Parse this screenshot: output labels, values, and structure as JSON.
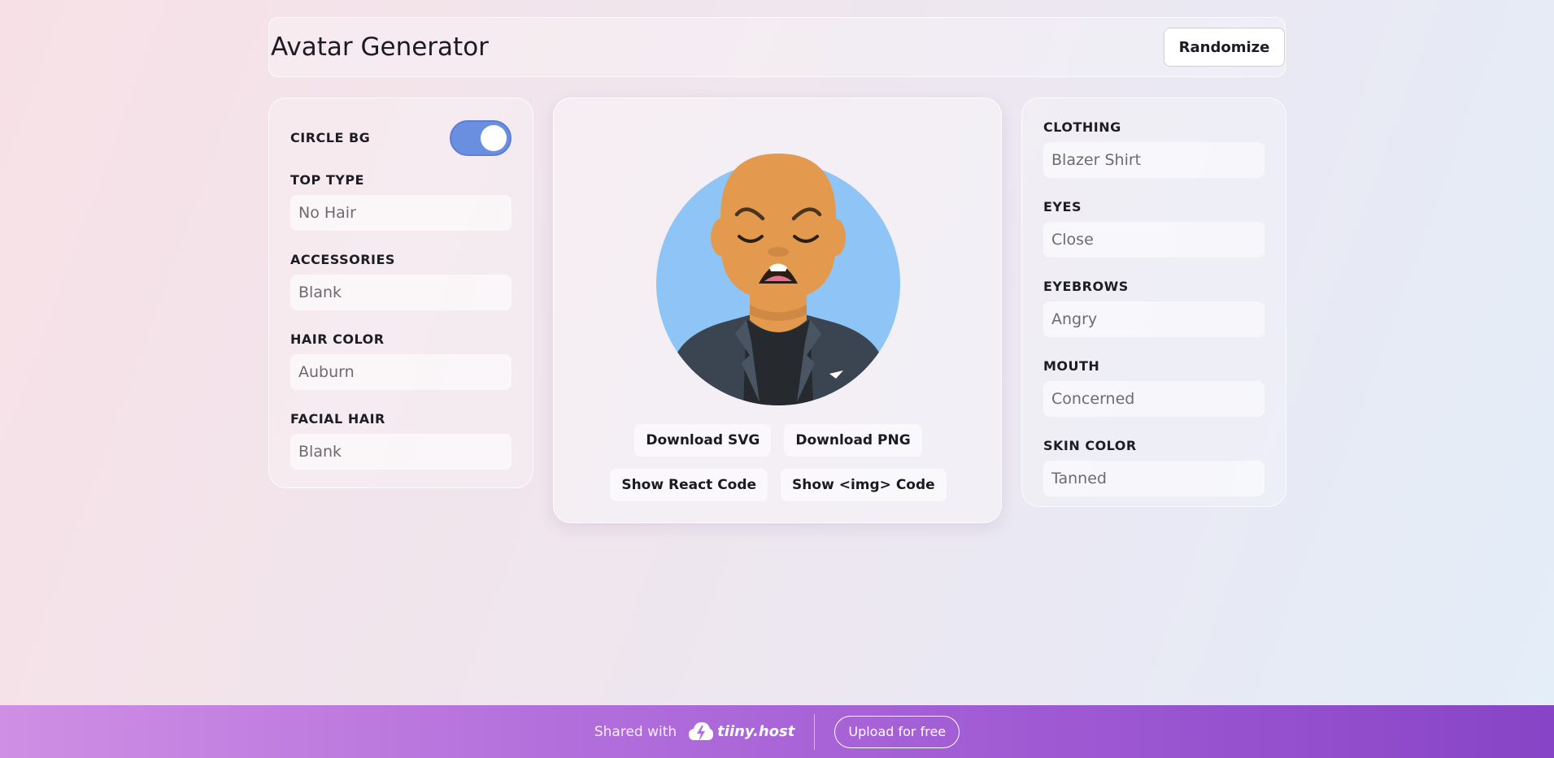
{
  "header": {
    "title": "Avatar Generator",
    "randomize_label": "Randomize"
  },
  "left_panel": {
    "circle_bg": {
      "label": "CIRCLE BG",
      "enabled": true
    },
    "fields": [
      {
        "label": "TOP TYPE",
        "value": "No Hair"
      },
      {
        "label": "ACCESSORIES",
        "value": "Blank"
      },
      {
        "label": "HAIR COLOR",
        "value": "Auburn"
      },
      {
        "label": "FACIAL HAIR",
        "value": "Blank"
      }
    ]
  },
  "right_panel": {
    "fields": [
      {
        "label": "CLOTHING",
        "value": "Blazer Shirt"
      },
      {
        "label": "EYES",
        "value": "Close"
      },
      {
        "label": "EYEBROWS",
        "value": "Angry"
      },
      {
        "label": "MOUTH",
        "value": "Concerned"
      },
      {
        "label": "SKIN COLOR",
        "value": "Tanned"
      }
    ]
  },
  "center_panel": {
    "buttons": {
      "download_svg": "Download SVG",
      "download_png": "Download PNG",
      "show_react": "Show React Code",
      "show_img": "Show <img> Code"
    }
  },
  "footer": {
    "shared_with": "Shared with",
    "brand": "tiiny.host",
    "upload_label": "Upload for free"
  },
  "colors": {
    "toggle_on": "#6b8fe0",
    "avatar_circle": "#8ec4f6",
    "skin_tanned": "#e39a4e",
    "blazer": "#3b4551",
    "shirt": "#262a2e",
    "footer_start": "#cf8fe4",
    "footer_end": "#8744c6"
  }
}
